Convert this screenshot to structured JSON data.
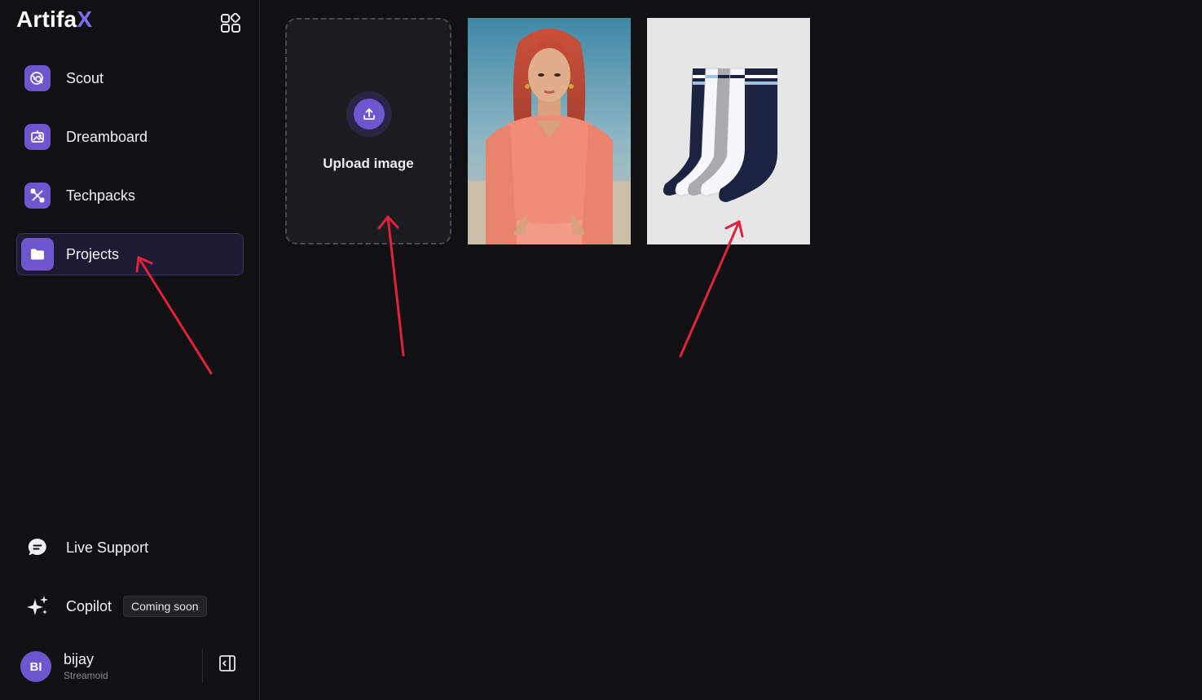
{
  "app": {
    "brand_main": "Artifa",
    "brand_accent": "X"
  },
  "sidebar": {
    "items": [
      {
        "label": "Scout",
        "icon": "globe-search-icon"
      },
      {
        "label": "Dreamboard",
        "icon": "board-image-icon"
      },
      {
        "label": "Techpacks",
        "icon": "tools-icon"
      },
      {
        "label": "Projects",
        "icon": "folder-icon",
        "active": true
      }
    ],
    "live_support": "Live Support",
    "copilot": "Copilot",
    "copilot_badge": "Coming soon",
    "user": {
      "initials": "BI",
      "name": "bijay",
      "org": "Streamoid"
    }
  },
  "main": {
    "upload_label": "Upload image",
    "images": [
      {
        "subject": "woman in coral dress"
      },
      {
        "subject": "striped socks"
      }
    ]
  },
  "colors": {
    "accent": "#6e56cf",
    "annotation": "#e0223a",
    "background": "#111113"
  }
}
